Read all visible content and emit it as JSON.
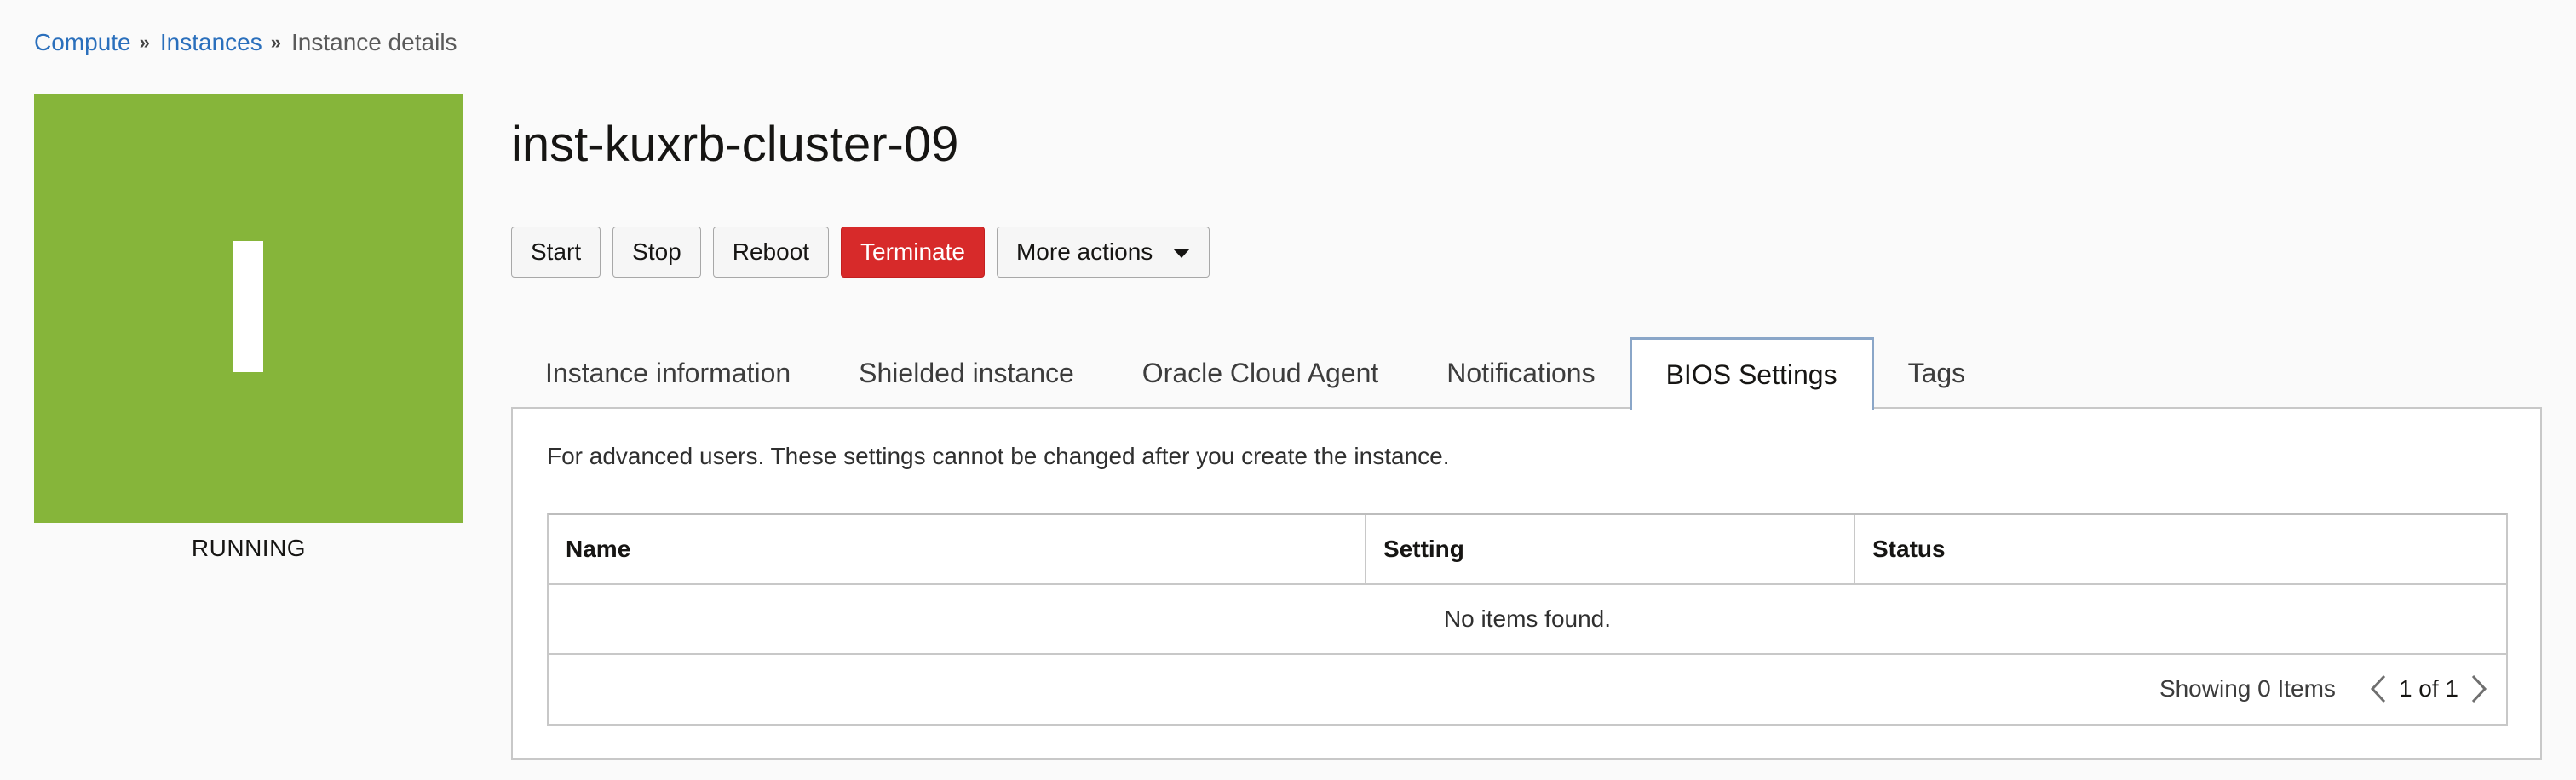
{
  "breadcrumb": {
    "items": [
      "Compute",
      "Instances"
    ],
    "current": "Instance details",
    "separator": "»"
  },
  "instance": {
    "title": "inst-kuxrb-cluster-09",
    "status": "RUNNING",
    "tile_color": "#86b53a",
    "tile_glyph": "I"
  },
  "actions": {
    "start": "Start",
    "stop": "Stop",
    "reboot": "Reboot",
    "terminate": "Terminate",
    "more": "More actions"
  },
  "tabs": [
    {
      "label": "Instance information",
      "active": false
    },
    {
      "label": "Shielded instance",
      "active": false
    },
    {
      "label": "Oracle Cloud Agent",
      "active": false
    },
    {
      "label": "Notifications",
      "active": false
    },
    {
      "label": "BIOS Settings",
      "active": true
    },
    {
      "label": "Tags",
      "active": false
    }
  ],
  "panel": {
    "description": "For advanced users. These settings cannot be changed after you create the instance.",
    "table": {
      "columns": [
        "Name",
        "Setting",
        "Status"
      ],
      "empty_message": "No items found.",
      "showing": "Showing 0 Items",
      "page": "1 of 1"
    }
  },
  "colors": {
    "link": "#2a6fbc",
    "danger": "#d72a2a",
    "active_tab_border": "#8aa6c8"
  }
}
